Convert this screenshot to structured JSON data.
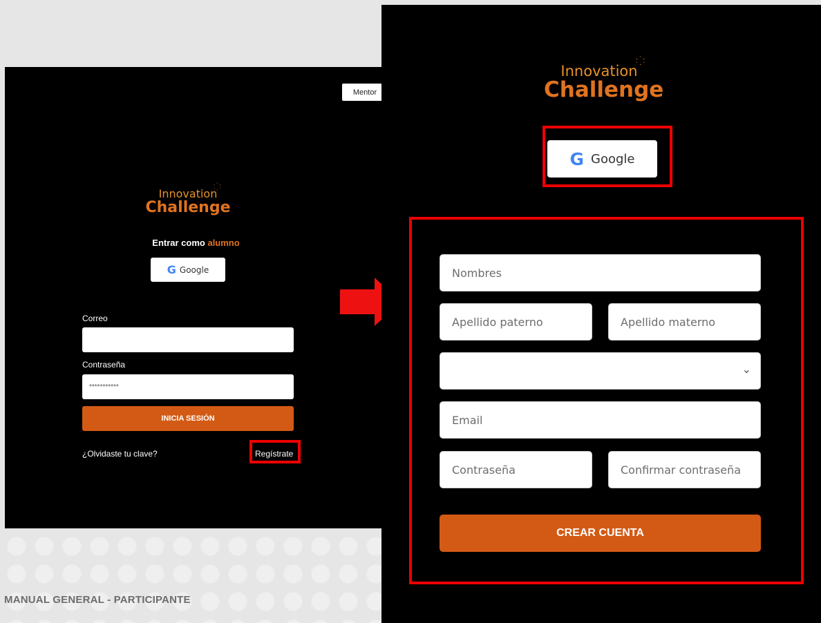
{
  "footer": {
    "text": "MANUAL GENERAL - PARTICIPANTE"
  },
  "login": {
    "mentor_label": "Mentor",
    "logo": {
      "line1": "Innovation",
      "line2": "Challenge"
    },
    "entrar_prefix": "Entrar como ",
    "entrar_role": "alumno",
    "google_label": "Google",
    "correo_label": "Correo",
    "correo_value": "",
    "password_label": "Contraseña",
    "password_value": "***********",
    "login_button": "INICIA SESIÓN",
    "forgot_link": "¿Olvidaste tu clave?",
    "register_link": "Regístrate"
  },
  "register": {
    "logo": {
      "line1": "Innovation",
      "line2": "Challenge"
    },
    "google_label": "Google",
    "fields": {
      "nombres": "Nombres",
      "apellido_paterno": "Apellido paterno",
      "apellido_materno": "Apellido materno",
      "select_value": "",
      "email": "Email",
      "password": "Contraseña",
      "confirm_password": "Confirmar contraseña"
    },
    "create_button": "CREAR CUENTA"
  },
  "colors": {
    "accent": "#d35a14",
    "highlight": "#e00000",
    "logo_orange": "#e0731f"
  },
  "icons": {
    "google": "google-g-icon",
    "arrow": "arrow-right-icon",
    "select": "chevron-down-icon"
  }
}
